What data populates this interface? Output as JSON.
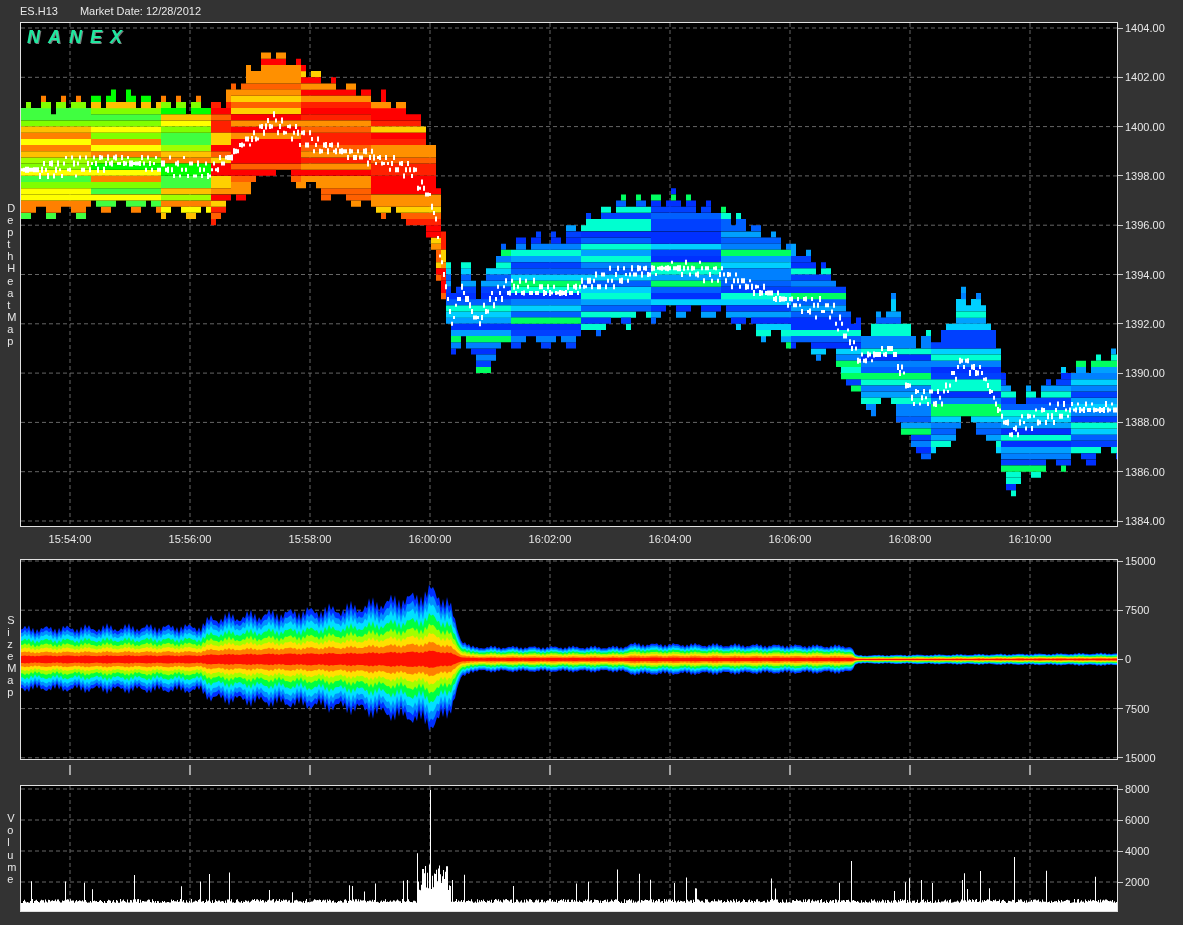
{
  "header": {
    "symbol": "ES.H13",
    "market_date": "Market Date: 12/28/2012"
  },
  "logo": "NANEX",
  "depth_heat_map": {
    "side_label": "Depth Heat Map",
    "y_ticks": [
      "1404.00",
      "1402.00",
      "1400.00",
      "1398.00",
      "1396.00",
      "1394.00",
      "1392.00",
      "1390.00",
      "1388.00",
      "1386.00",
      "1384.00"
    ]
  },
  "time_axis": {
    "ticks": [
      "15:54:00",
      "15:56:00",
      "15:58:00",
      "16:00:00",
      "16:02:00",
      "16:04:00",
      "16:06:00",
      "16:08:00",
      "16:10:00"
    ]
  },
  "size_map": {
    "side_label": "Size Map",
    "y_ticks": [
      "15000",
      "7500",
      "0",
      "7500",
      "15000"
    ]
  },
  "volume": {
    "side_label": "Volume",
    "y_ticks": [
      "8000",
      "6000",
      "4000",
      "2000"
    ]
  }
}
